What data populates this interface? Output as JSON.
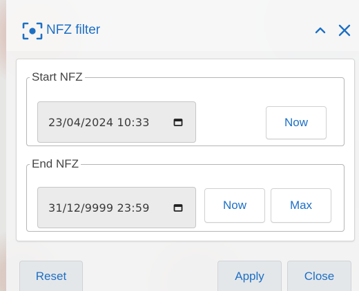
{
  "dialog": {
    "title": "NFZ filter",
    "icons": {
      "title": "focus-target-icon",
      "collapse": "chevron-up-icon",
      "close": "close-icon"
    }
  },
  "start": {
    "legend": "Start NFZ",
    "value": "23/04/2024 10:33",
    "now_label": "Now"
  },
  "end": {
    "legend": "End NFZ",
    "value": "31/12/9999 23:59",
    "now_label": "Now",
    "max_label": "Max"
  },
  "footer": {
    "reset_label": "Reset",
    "apply_label": "Apply",
    "close_label": "Close"
  },
  "colors": {
    "accent": "#1d6fc4",
    "panel_bg": "#f4f4f4",
    "input_bg": "#ebebeb"
  }
}
